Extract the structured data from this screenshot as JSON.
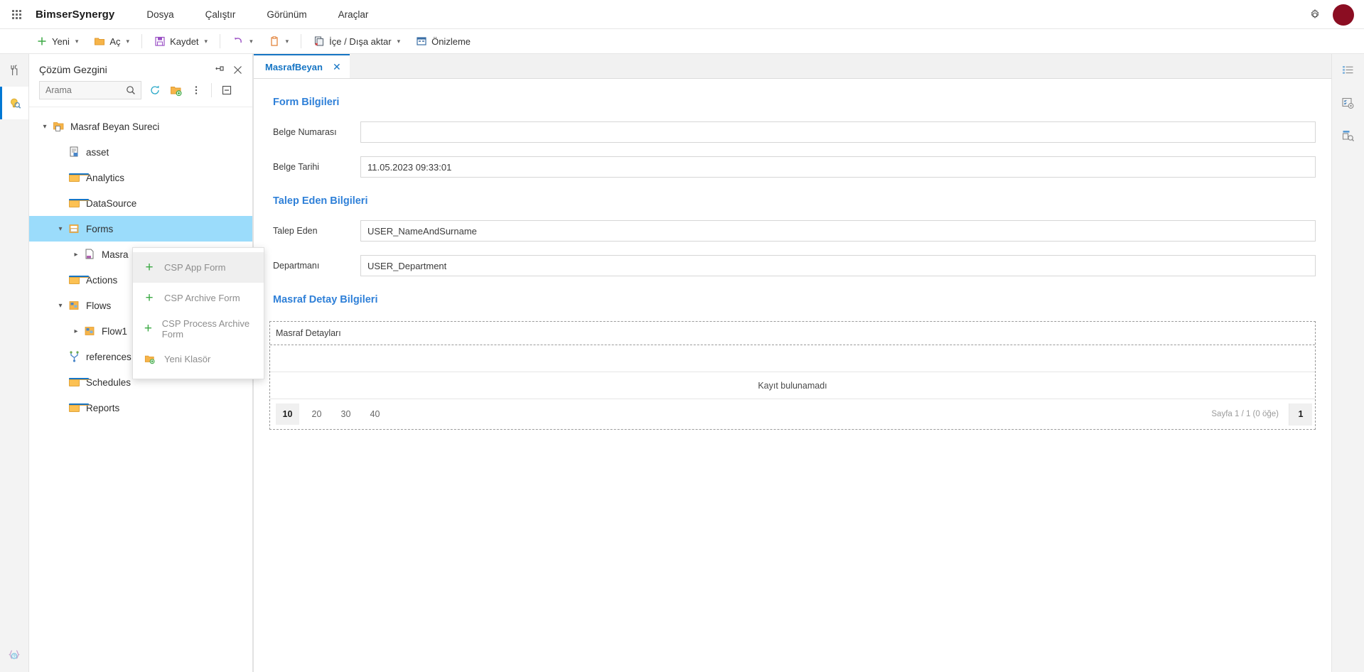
{
  "header": {
    "brand": "BimserSynergy",
    "menu": [
      "Dosya",
      "Çalıştır",
      "Görünüm",
      "Araçlar"
    ],
    "waffle_icon": "app-launcher-icon",
    "settings_icon": "gear-icon",
    "avatar_color": "#8b0d22"
  },
  "ribbon": {
    "items": [
      {
        "label": "Yeni",
        "icon": "plus-icon",
        "caret": true
      },
      {
        "label": "Aç",
        "icon": "open-folder-icon",
        "caret": true
      },
      {
        "label": "Kaydet",
        "icon": "save-disk-icon",
        "caret": true
      },
      {
        "label": "",
        "icon": "undo-icon",
        "caret": true
      },
      {
        "label": "",
        "icon": "clipboard-icon",
        "caret": true
      },
      {
        "label": "İçe / Dışa aktar",
        "icon": "import-export-icon",
        "caret": true
      },
      {
        "label": "Önizleme",
        "icon": "preview-icon",
        "caret": false
      }
    ]
  },
  "left_rail": {
    "items": [
      {
        "name": "tools-icon",
        "active": false
      },
      {
        "name": "solution-explorer-icon",
        "active": true
      }
    ],
    "bottom": {
      "name": "code-snippet-icon"
    }
  },
  "explorer": {
    "title": "Çözüm Gezgini",
    "pin_icon": "pin-icon",
    "close_icon": "close-icon",
    "search": {
      "value": "",
      "placeholder": "Arama"
    },
    "search_icon": "search-icon",
    "refresh_icon": "refresh-icon",
    "new_folder_icon": "new-folder-icon",
    "more_icon": "more-options-icon",
    "collapse_icon": "collapse-all-icon",
    "tree": [
      {
        "label": "Masraf Beyan Sureci",
        "icon": "solution-icon",
        "indent": 0,
        "twisty": "down",
        "selected": false
      },
      {
        "label": "asset",
        "icon": "asset-icon",
        "indent": 1,
        "twisty": "none",
        "selected": false
      },
      {
        "label": "Analytics",
        "icon": "folder-icon",
        "indent": 1,
        "twisty": "none",
        "selected": false
      },
      {
        "label": "DataSource",
        "icon": "folder-icon",
        "indent": 1,
        "twisty": "none",
        "selected": false
      },
      {
        "label": "Forms",
        "icon": "forms-icon",
        "indent": 1,
        "twisty": "down",
        "selected": true
      },
      {
        "label": "Masra",
        "icon": "form-page-icon",
        "indent": 2,
        "twisty": "right",
        "selected": false
      },
      {
        "label": "Actions",
        "icon": "folder-icon",
        "indent": 1,
        "twisty": "none",
        "selected": false
      },
      {
        "label": "Flows",
        "icon": "flows-icon",
        "indent": 1,
        "twisty": "down",
        "selected": false
      },
      {
        "label": "Flow1",
        "icon": "flow-icon",
        "indent": 2,
        "twisty": "right",
        "selected": false
      },
      {
        "label": "references",
        "icon": "references-icon",
        "indent": 1,
        "twisty": "none",
        "selected": false
      },
      {
        "label": "Schedules",
        "icon": "folder-icon",
        "indent": 1,
        "twisty": "none",
        "selected": false
      },
      {
        "label": "Reports",
        "icon": "folder-icon",
        "indent": 1,
        "twisty": "none",
        "selected": false
      }
    ]
  },
  "context_menu": {
    "items": [
      {
        "label": "CSP App Form",
        "icon": "plus-icon",
        "highlighted": true
      },
      {
        "label": "CSP Archive Form",
        "icon": "plus-icon",
        "highlighted": false
      },
      {
        "label": "CSP Process Archive Form",
        "icon": "plus-icon",
        "highlighted": false
      },
      {
        "label": "Yeni Klasör",
        "icon": "new-folder-icon",
        "highlighted": false
      }
    ]
  },
  "main": {
    "tab": {
      "label": "MasrafBeyan",
      "close_icon": "close-icon"
    },
    "sections": [
      {
        "title": "Form Bilgileri"
      },
      {
        "title": "Talep Eden Bilgileri"
      },
      {
        "title": "Masraf Detay Bilgileri"
      }
    ],
    "fields": [
      {
        "label": "Belge Numarası",
        "value": ""
      },
      {
        "label": "Belge Tarihi",
        "value": "11.05.2023 09:33:01"
      },
      {
        "label": "Talep Eden",
        "value": "USER_NameAndSurname"
      },
      {
        "label": "Departmanı",
        "value": "USER_Department"
      }
    ],
    "grid": {
      "caption": "Masraf Detayları",
      "empty_text": "Kayıt bulunamadı",
      "page_sizes": [
        "10",
        "20",
        "30",
        "40"
      ],
      "page_size_selected": "10",
      "page_info": "Sayfa 1 / 1 (0 öğe)",
      "current_page": "1"
    }
  },
  "right_rail": {
    "items": [
      {
        "name": "properties-panel-icon"
      },
      {
        "name": "settings-panel-icon"
      },
      {
        "name": "inspect-panel-icon"
      }
    ]
  }
}
